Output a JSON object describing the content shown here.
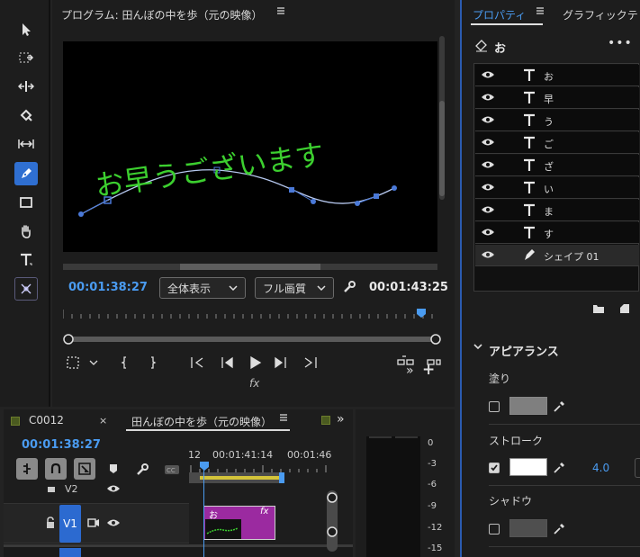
{
  "program_monitor": {
    "title": "プログラム: 田んぼの中を歩（元の映像）",
    "menu_icon": "hamburger-icon",
    "overlay_text": "お早うございます",
    "timecode_current": "00:01:38:27",
    "zoom_select": "全体表示",
    "quality_select": "フル画質",
    "timecode_duration": "00:01:43:25",
    "fx_label": "fx",
    "controls": [
      "mark-in",
      "mark-out",
      "go-to-in",
      "step-back",
      "play",
      "step-forward",
      "go-to-out",
      "lift",
      "extract"
    ]
  },
  "toolbar": {
    "tools": [
      "selection-tool",
      "track-select-tool",
      "ripple-edit-tool",
      "razor-tool",
      "slip-tool",
      "pen-tool",
      "rectangle-tool",
      "hand-tool",
      "type-tool",
      "remix-tool"
    ],
    "active": "pen-tool"
  },
  "properties": {
    "tab_active": "プロパティ",
    "tab_other": "グラフィックテ",
    "selected_name": "お",
    "layers": [
      {
        "name": "お",
        "kind": "text"
      },
      {
        "name": "早",
        "kind": "text"
      },
      {
        "name": "う",
        "kind": "text"
      },
      {
        "name": "ご",
        "kind": "text"
      },
      {
        "name": "ざ",
        "kind": "text"
      },
      {
        "name": "い",
        "kind": "text"
      },
      {
        "name": "ま",
        "kind": "text"
      },
      {
        "name": "す",
        "kind": "text"
      },
      {
        "name": "シェイプ 01",
        "kind": "shape"
      }
    ],
    "appearance_label": "アピアランス",
    "fill": {
      "label": "塗り",
      "checked": false,
      "color": "#7f7f7f"
    },
    "stroke": {
      "label": "ストローク",
      "checked": true,
      "color": "#ffffff",
      "width": "4.0"
    },
    "shadow": {
      "label": "シャドウ",
      "checked": false,
      "color": "#4f4f4f"
    }
  },
  "timeline": {
    "tab1": "C0012",
    "tab1_close": "×",
    "tab2": "田んぼの中を歩（元の映像）",
    "timecode": "00:01:38:27",
    "ruler_labels": [
      "12",
      "00:01:41:14",
      "00:01:46"
    ],
    "track_v2": "V2",
    "track_v1": "V1",
    "clip_label": "お",
    "clip_fx": "fx"
  },
  "audio_meter": {
    "labels": [
      "0",
      "-3",
      "-6",
      "-9",
      "-12",
      "-15"
    ]
  },
  "colors": {
    "accent": "#4a9bf0",
    "text_green": "#3ccf2f",
    "clip_purple": "#9b2aa0",
    "active_tool": "#2f6fd1"
  }
}
